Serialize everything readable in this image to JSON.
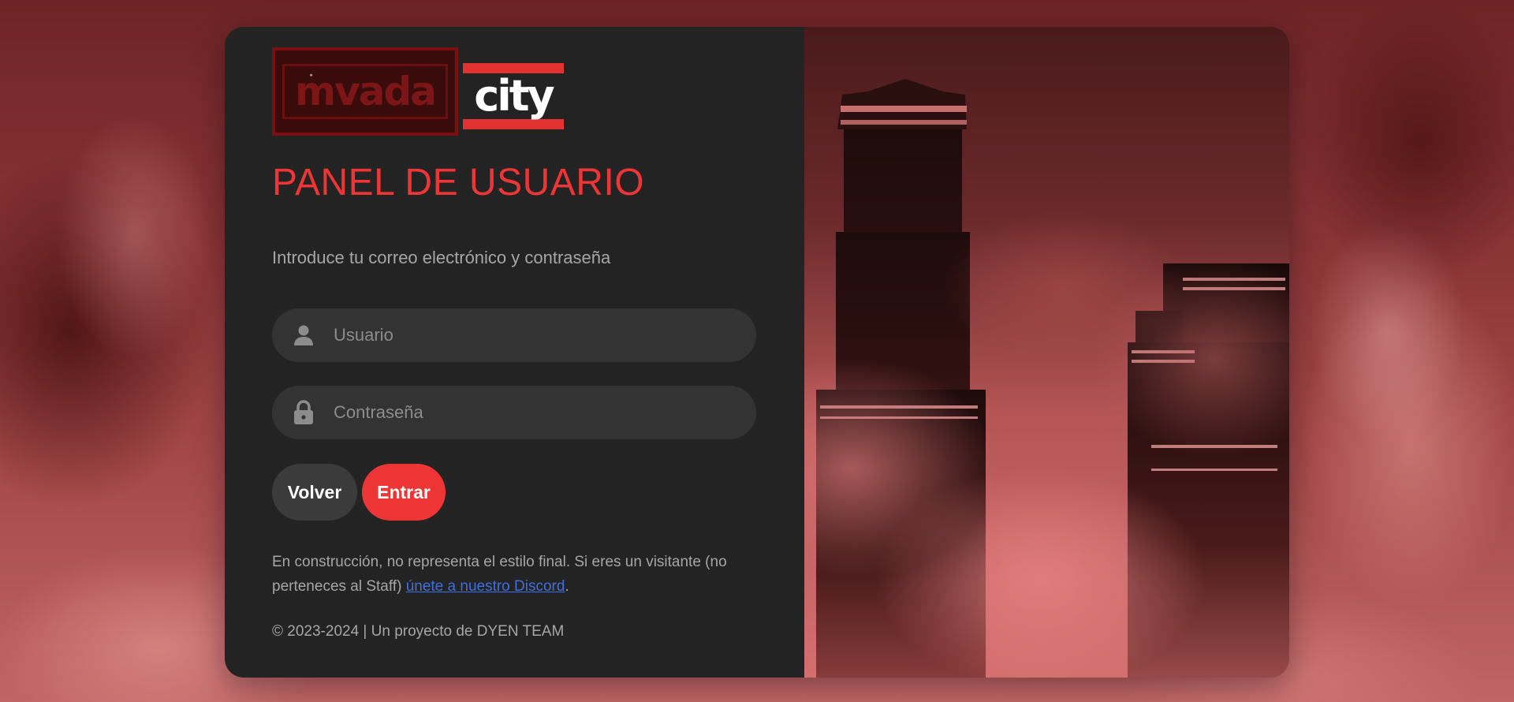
{
  "logo": {
    "part1": "mvada",
    "part2": "city"
  },
  "page": {
    "title": "PANEL DE USUARIO",
    "subtitle": "Introduce tu correo electrónico y contraseña"
  },
  "form": {
    "username_placeholder": "Usuario",
    "username_icon": "user-icon",
    "password_placeholder": "Contraseña",
    "password_icon": "lock-icon"
  },
  "buttons": {
    "back_label": "Volver",
    "enter_label": "Entrar"
  },
  "note": {
    "text_before": "En construcción, no representa el estilo final. Si eres un visitante (no perteneces al Staff) ",
    "link_text": "únete a nuestro Discord",
    "text_after": "."
  },
  "footer": {
    "copyright": "© 2023-2024 | Un proyecto de DYEN TEAM"
  },
  "colors": {
    "accent": "#ee3535",
    "panel_bg": "#232323",
    "field_bg": "#333333",
    "link": "#3d6fe0"
  }
}
